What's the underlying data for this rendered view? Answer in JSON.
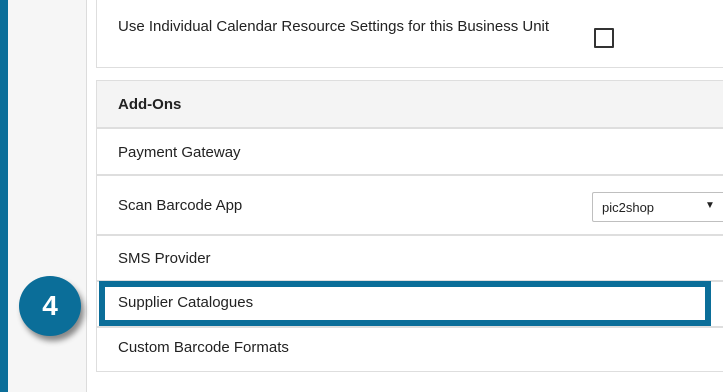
{
  "settings_row": {
    "label": "Use Individual Calendar Resource Settings for this Business Unit",
    "checked": false
  },
  "addons": {
    "header": "Add-Ons",
    "items": [
      {
        "label": "Payment Gateway"
      },
      {
        "label": "Scan Barcode App",
        "select_value": "pic2shop"
      },
      {
        "label": "SMS Provider"
      },
      {
        "label": "Supplier Catalogues",
        "highlighted": true
      },
      {
        "label": "Custom Barcode Formats"
      }
    ]
  },
  "step_badge": {
    "number": "4"
  },
  "colors": {
    "accent": "#0b6e99",
    "header_bg": "#f4f4f4",
    "border": "#dedede"
  },
  "icons": {
    "dropdown": "caret-down-icon",
    "checkbox": "checkbox-icon"
  }
}
